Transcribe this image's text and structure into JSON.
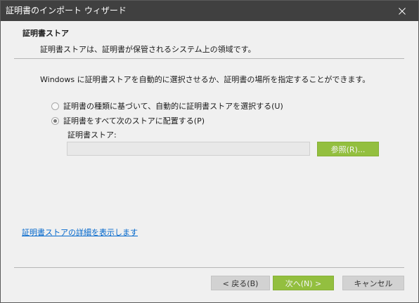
{
  "window": {
    "title": "証明書のインポート ウィザード"
  },
  "header": {
    "title": "証明書ストア",
    "description": "証明書ストアは、証明書が保管されるシステム上の領域です。"
  },
  "body": {
    "intro": "Windows に証明書ストアを自動的に選択させるか、証明書の場所を指定することができます。",
    "options": [
      {
        "label": "証明書の種類に基づいて、自動的に証明書ストアを選択する(U)",
        "selected": false
      },
      {
        "label": "証明書をすべて次のストアに配置する(P)",
        "selected": true
      }
    ],
    "store_label": "証明書ストア:",
    "store_value": "",
    "browse_label": "参照(R)...",
    "details_link": "証明書ストアの詳細を表示します"
  },
  "footer": {
    "back_label": "< 戻る(B)",
    "next_label": "次へ(N) >",
    "cancel_label": "キャンセル"
  },
  "colors": {
    "title_bar": "#404040",
    "window_bg": "#f0f0f0",
    "text": "#1a1a1a",
    "accent": "#93bf3f",
    "button_gray": "#d2d2d2",
    "link": "#0066cc"
  }
}
